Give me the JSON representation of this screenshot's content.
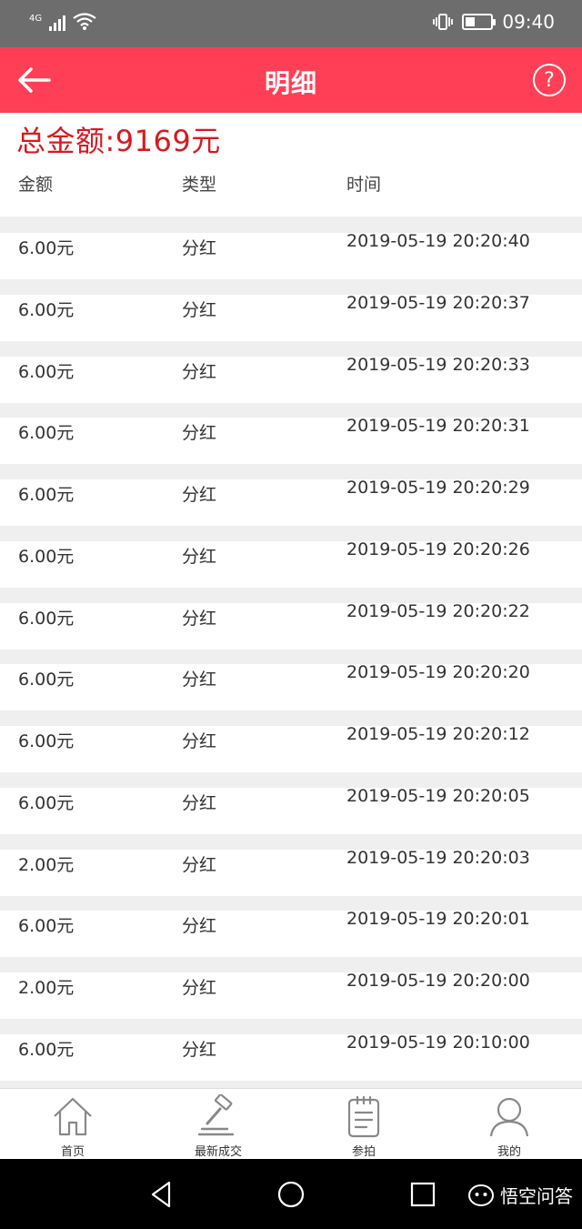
{
  "status_bar": {
    "network": "4G",
    "time": "09:40"
  },
  "header": {
    "title": "明细",
    "back_icon": "arrow-left-icon",
    "help_icon": "question-circle-icon",
    "help_symbol": "?"
  },
  "summary": {
    "total_label": "总金额:9169元"
  },
  "table": {
    "columns": [
      "金额",
      "类型",
      "时间"
    ],
    "rows": [
      {
        "amount": "6.00元",
        "type": "分红",
        "time": "2019-05-19 20:20:40"
      },
      {
        "amount": "6.00元",
        "type": "分红",
        "time": "2019-05-19 20:20:37"
      },
      {
        "amount": "6.00元",
        "type": "分红",
        "time": "2019-05-19 20:20:33"
      },
      {
        "amount": "6.00元",
        "type": "分红",
        "time": "2019-05-19 20:20:31"
      },
      {
        "amount": "6.00元",
        "type": "分红",
        "time": "2019-05-19 20:20:29"
      },
      {
        "amount": "6.00元",
        "type": "分红",
        "time": "2019-05-19 20:20:26"
      },
      {
        "amount": "6.00元",
        "type": "分红",
        "time": "2019-05-19 20:20:22"
      },
      {
        "amount": "6.00元",
        "type": "分红",
        "time": "2019-05-19 20:20:20"
      },
      {
        "amount": "6.00元",
        "type": "分红",
        "time": "2019-05-19 20:20:12"
      },
      {
        "amount": "6.00元",
        "type": "分红",
        "time": "2019-05-19 20:20:05"
      },
      {
        "amount": "2.00元",
        "type": "分红",
        "time": "2019-05-19 20:20:03"
      },
      {
        "amount": "6.00元",
        "type": "分红",
        "time": "2019-05-19 20:20:01"
      },
      {
        "amount": "2.00元",
        "type": "分红",
        "time": "2019-05-19 20:20:00"
      },
      {
        "amount": "6.00元",
        "type": "分红",
        "time": "2019-05-19 20:10:00"
      }
    ]
  },
  "bottom_nav": {
    "items": [
      {
        "label": "首页",
        "icon": "home-icon"
      },
      {
        "label": "最新成交",
        "icon": "auction-hammer-icon"
      },
      {
        "label": "参拍",
        "icon": "clipboard-icon"
      },
      {
        "label": "我的",
        "icon": "user-icon"
      }
    ]
  },
  "watermark": {
    "text": "悟空问答"
  },
  "colors": {
    "header_bg": "#ff3f55",
    "total_text": "#d9191f",
    "status_bar_bg": "#6d6d6d",
    "row_separator": "#efefef"
  }
}
